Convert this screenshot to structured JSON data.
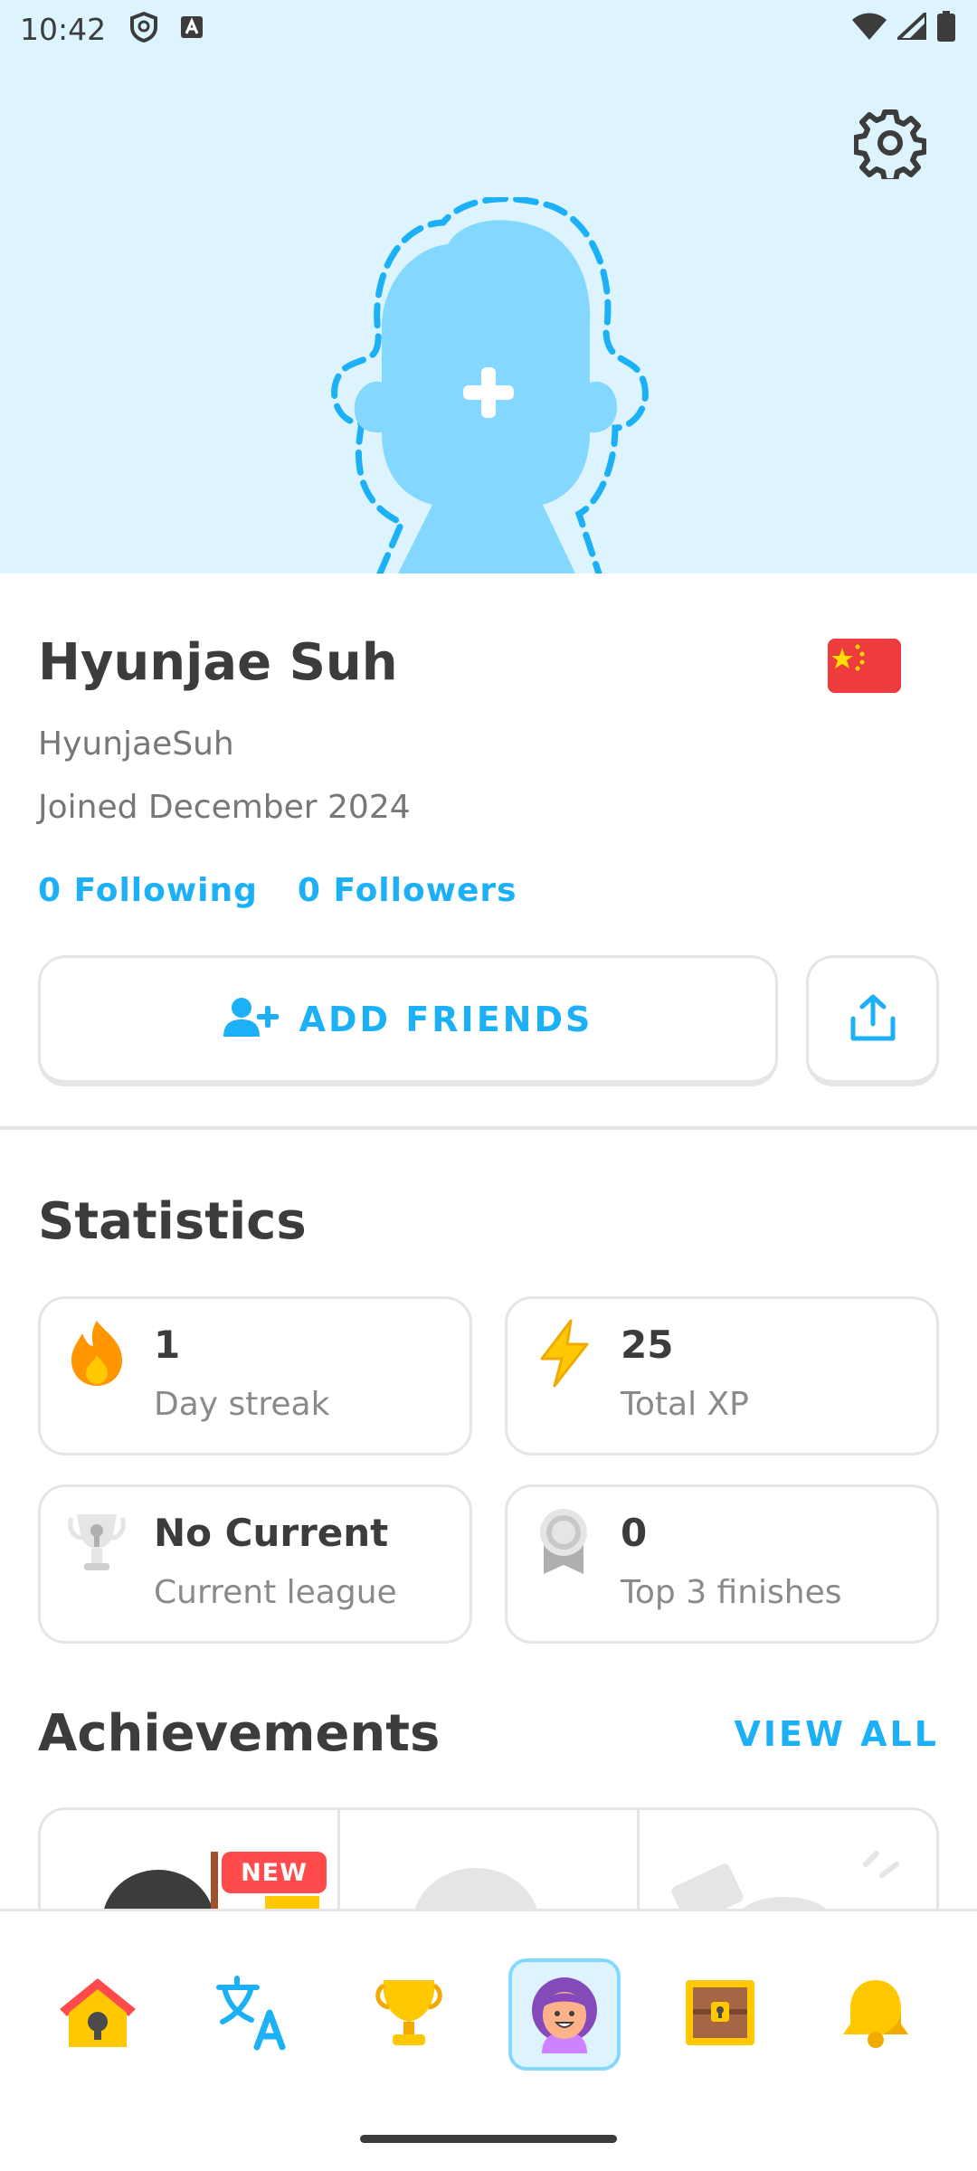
{
  "status_bar": {
    "time": "10:42",
    "left_icons": [
      "shield-icon",
      "a-box-icon"
    ],
    "right_icons": [
      "wifi-icon",
      "cell-signal-icon",
      "battery-icon"
    ]
  },
  "header": {
    "settings_icon": "gear-icon",
    "avatar_placeholder_icon": "add-avatar-icon",
    "background_color": "#ddf4ff"
  },
  "profile": {
    "display_name": "Hyunjae Suh",
    "username": "HyunjaeSuh",
    "joined": "Joined December 2024",
    "flag_icon": "china-flag-icon",
    "following": "0 Following",
    "followers": "0 Followers",
    "add_friends_label": "ADD FRIENDS",
    "share_icon": "share-icon"
  },
  "statistics": {
    "title": "Statistics",
    "cards": [
      {
        "icon": "fire-icon",
        "value": "1",
        "label": "Day streak"
      },
      {
        "icon": "lightning-icon",
        "value": "25",
        "label": "Total XP"
      },
      {
        "icon": "trophy-icon",
        "value": "No Current",
        "label": "Current league"
      },
      {
        "icon": "medal-icon",
        "value": "0",
        "label": "Top 3 finishes"
      }
    ]
  },
  "achievements": {
    "title": "Achievements",
    "view_all": "VIEW ALL",
    "new_badge": "NEW"
  },
  "bottom_nav": {
    "items": [
      "home-icon",
      "language-icon",
      "leaderboard-icon",
      "profile-icon",
      "chest-icon",
      "notifications-icon"
    ],
    "active": "profile-icon"
  },
  "colors": {
    "accent_blue": "#1cb0f6",
    "border_gray": "#e5e5e5",
    "text_dark": "#3c3c3c",
    "text_muted": "#777777",
    "badge_red": "#ff4b4b"
  }
}
